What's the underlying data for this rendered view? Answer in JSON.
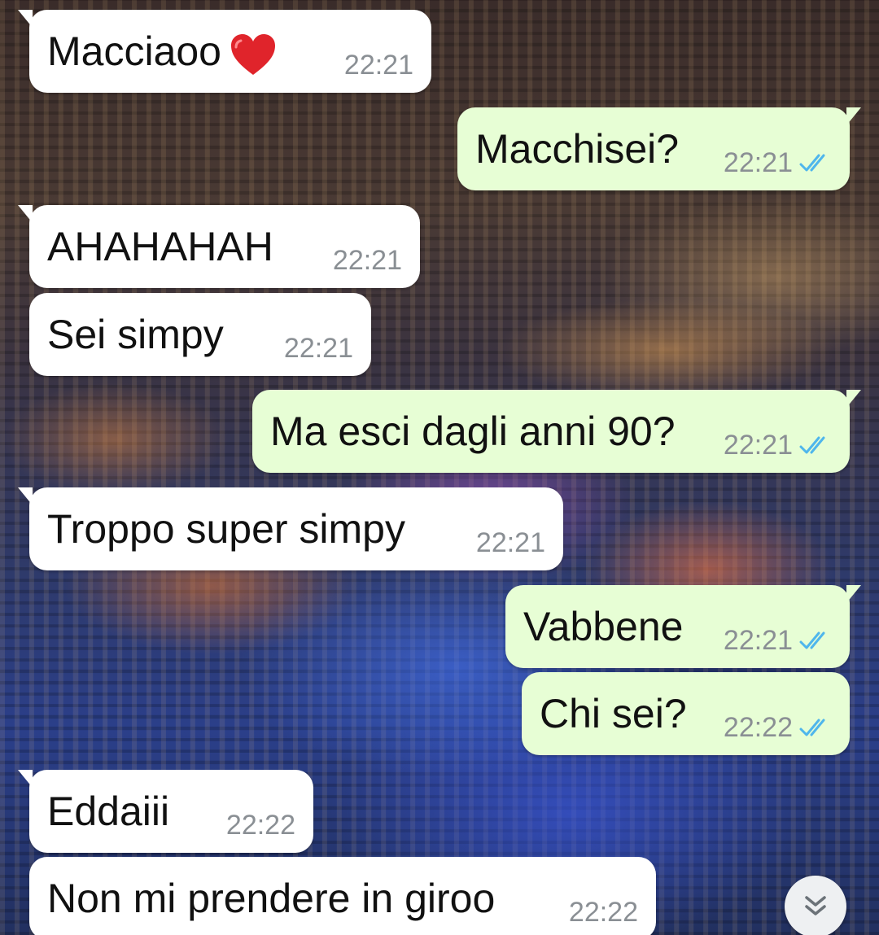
{
  "chat": {
    "messages": [
      {
        "text": "Macciaoo",
        "emoji": "red-heart",
        "time": "22:21",
        "direction": "in"
      },
      {
        "text": "Macchisei?",
        "time": "22:21",
        "direction": "out",
        "status": "read"
      },
      {
        "text": "AHAHAHAH",
        "time": "22:21",
        "direction": "in"
      },
      {
        "text": "Sei simpy",
        "time": "22:21",
        "direction": "in"
      },
      {
        "text": "Ma esci dagli anni 90?",
        "time": "22:21",
        "direction": "out",
        "status": "read"
      },
      {
        "text": "Troppo super simpy",
        "time": "22:21",
        "direction": "in"
      },
      {
        "text": "Vabbene",
        "time": "22:21",
        "direction": "out",
        "status": "read"
      },
      {
        "text": "Chi sei?",
        "time": "22:22",
        "direction": "out",
        "status": "read"
      },
      {
        "text": "Eddaiii",
        "time": "22:22",
        "direction": "in"
      },
      {
        "text": "Non mi prendere in giroo",
        "time": "22:22",
        "direction": "in"
      }
    ]
  },
  "colors": {
    "incoming_bubble": "#ffffff",
    "outgoing_bubble": "#e7fed5",
    "read_tick": "#4fb6ec",
    "timestamp": "#8a8f94"
  },
  "icons": {
    "read_receipt": "double-check-icon",
    "scroll_down": "double-chevron-down-icon"
  }
}
